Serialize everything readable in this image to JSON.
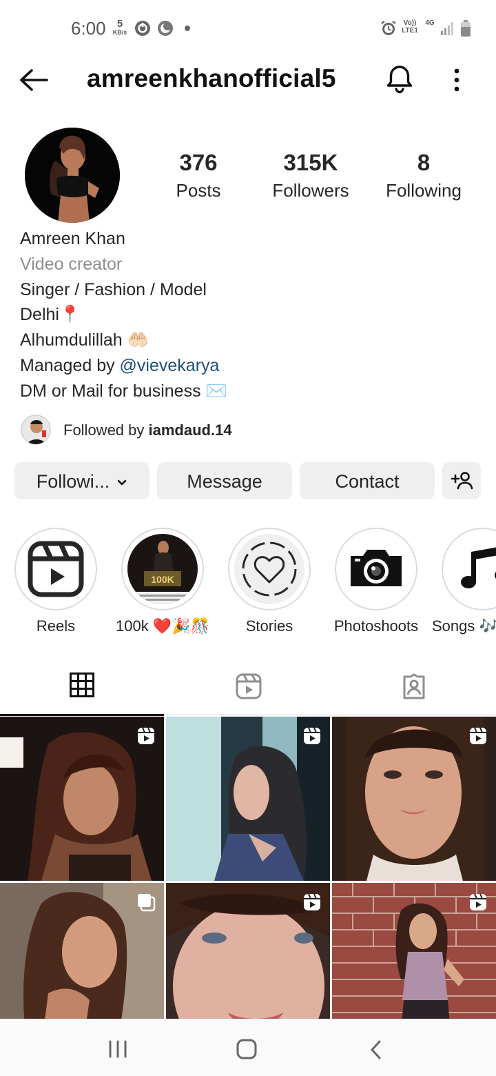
{
  "status_bar": {
    "time": "6:00",
    "speed_value": "5",
    "speed_unit": "KB/s",
    "network_label": "Vo)) LTE1",
    "network_type": "4G"
  },
  "header": {
    "username": "amreenkhanofficial5"
  },
  "stats": [
    {
      "value": "376",
      "label": "Posts"
    },
    {
      "value": "315K",
      "label": "Followers"
    },
    {
      "value": "8",
      "label": "Following"
    }
  ],
  "bio": {
    "name": "Amreen Khan",
    "category": "Video creator",
    "line1": "Singer / Fashion / Model",
    "line2": "Delhi📍",
    "line3": "Alhumdulillah 🤲🏻",
    "managed_prefix": "Managed by ",
    "managed_handle": "@vievekarya",
    "line5": "DM or Mail for business ✉️"
  },
  "followed_by": {
    "prefix": "Followed by ",
    "user": "iamdaud.14"
  },
  "buttons": {
    "following": "Followi...",
    "message": "Message",
    "contact": "Contact"
  },
  "highlights": [
    {
      "label": "Reels"
    },
    {
      "label": "100k ❤️🎉🎊"
    },
    {
      "label": "Stories"
    },
    {
      "label": "Photoshoots"
    },
    {
      "label": "Songs 🎶"
    }
  ],
  "highlight_thumb_text": "100K",
  "icons": {
    "back": "arrow-left-icon",
    "bell": "bell-icon",
    "more": "more-vertical-icon",
    "grid": "grid-icon",
    "reels": "reels-icon",
    "tagged": "tagged-icon"
  },
  "colors": {
    "button_bg": "#efefef",
    "mention": "#1e4f7a",
    "secondary_text": "#8e8e8e"
  }
}
